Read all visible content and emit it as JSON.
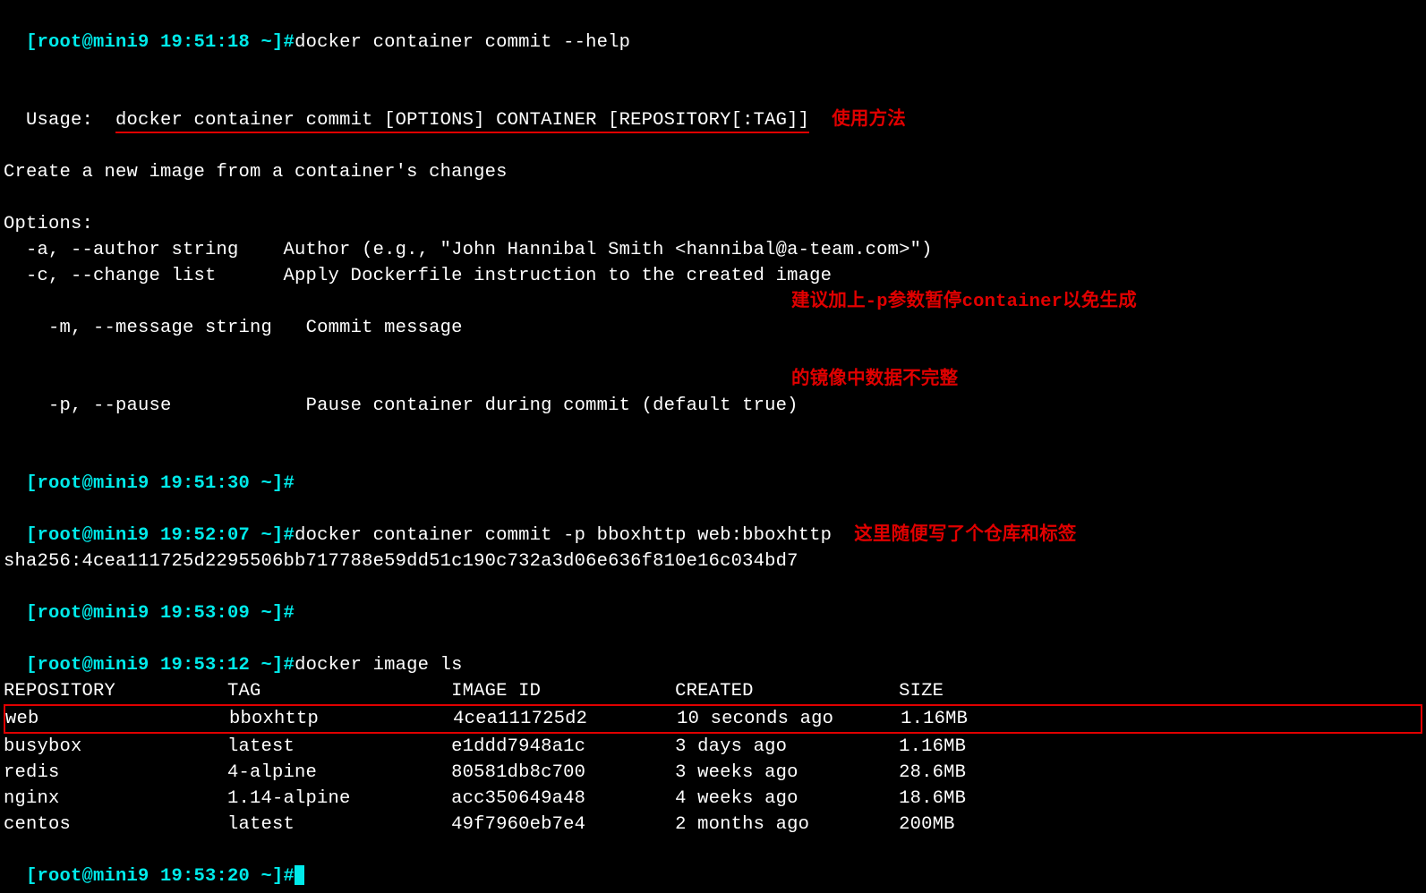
{
  "prompts": {
    "p1": "[root@mini9 19:51:18 ~]#",
    "p2": "[root@mini9 19:51:30 ~]#",
    "p3": "[root@mini9 19:52:07 ~]#",
    "p4": "[root@mini9 19:53:09 ~]#",
    "p5": "[root@mini9 19:53:12 ~]#",
    "p6": "[root@mini9 19:53:20 ~]#"
  },
  "commands": {
    "c1": "docker container commit --help",
    "c3": "docker container commit -p bboxhttp web:bboxhttp",
    "c5": "docker image ls"
  },
  "output": {
    "usage_label": "Usage:  ",
    "usage_text": "docker container commit [OPTIONS] CONTAINER [REPOSITORY[:TAG]]",
    "desc": "Create a new image from a container's changes",
    "options_label": "Options:",
    "opt_a": "  -a, --author string    Author (e.g., \"John Hannibal Smith <hannibal@a-team.com>\")",
    "opt_c": "  -c, --change list      Apply Dockerfile instruction to the created image",
    "opt_m": "  -m, --message string   Commit message",
    "opt_p": "  -p, --pause            Pause container during commit (default true)",
    "sha": "sha256:4cea111725d2295506bb717788e59dd51c190c732a3d06e636f810e16c034bd7",
    "table_header": "REPOSITORY          TAG                 IMAGE ID            CREATED             SIZE",
    "rows": {
      "r1": "web                 bboxhttp            4cea111725d2        10 seconds ago      1.16MB",
      "r2": "busybox             latest              e1ddd7948a1c        3 days ago          1.16MB",
      "r3": "redis               4-alpine            80581db8c700        3 weeks ago         28.6MB",
      "r4": "nginx               1.14-alpine         acc350649a48        4 weeks ago         18.6MB",
      "r5": "centos              latest              49f7960eb7e4        2 months ago        200MB"
    }
  },
  "chart_data": {
    "type": "table",
    "title": "docker image ls",
    "columns": [
      "REPOSITORY",
      "TAG",
      "IMAGE ID",
      "CREATED",
      "SIZE"
    ],
    "rows": [
      [
        "web",
        "bboxhttp",
        "4cea111725d2",
        "10 seconds ago",
        "1.16MB"
      ],
      [
        "busybox",
        "latest",
        "e1ddd7948a1c",
        "3 days ago",
        "1.16MB"
      ],
      [
        "redis",
        "4-alpine",
        "80581db8c700",
        "3 weeks ago",
        "28.6MB"
      ],
      [
        "nginx",
        "1.14-alpine",
        "acc350649a48",
        "4 weeks ago",
        "18.6MB"
      ],
      [
        "centos",
        "latest",
        "49f7960eb7e4",
        "2 months ago",
        "200MB"
      ]
    ]
  },
  "annotations": {
    "usage": "使用方法",
    "pause_line1": "建议加上-p参数暂停container以免生成",
    "pause_line2": "的镜像中数据不完整",
    "commit_repo": "这里随便写了个仓库和标签"
  }
}
